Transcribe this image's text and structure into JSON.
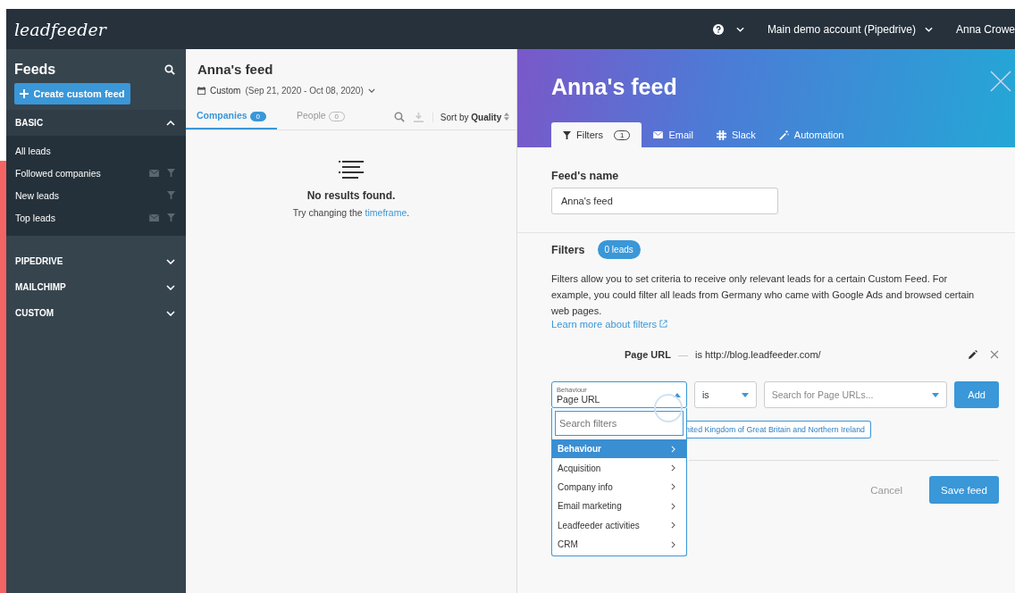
{
  "topbar": {
    "logo": "leadfeeder",
    "account": "Main demo account (Pipedrive)",
    "user": "Anna Crowe"
  },
  "sidebar": {
    "title": "Feeds",
    "create_button": "Create custom feed",
    "sections": [
      {
        "label": "BASIC",
        "expanded": true,
        "items": [
          {
            "label": "All leads",
            "email_alert": false,
            "filtered": false
          },
          {
            "label": "Followed companies",
            "email_alert": true,
            "filtered": true
          },
          {
            "label": "New leads",
            "email_alert": false,
            "filtered": true
          },
          {
            "label": "Top leads",
            "email_alert": true,
            "filtered": true
          }
        ]
      },
      {
        "label": "PIPEDRIVE",
        "expanded": false
      },
      {
        "label": "MAILCHIMP",
        "expanded": false
      },
      {
        "label": "CUSTOM",
        "expanded": false
      }
    ]
  },
  "feed": {
    "title": "Anna's feed",
    "range_label": "Custom",
    "range": "(Sep 21, 2020 - Oct 08, 2020)",
    "tabs": [
      {
        "label": "Companies",
        "count": "0",
        "selected": true
      },
      {
        "label": "People",
        "count": "0",
        "selected": false
      }
    ],
    "sort_label": "Sort by",
    "sort_value": "Quality",
    "empty_title": "No results found.",
    "empty_text": "Try changing the",
    "empty_link": "timeframe",
    "empty_end": "."
  },
  "editor": {
    "title": "Anna's feed",
    "tabs": [
      {
        "kind": "filter",
        "label": "Filters",
        "count": "1",
        "selected": true
      },
      {
        "kind": "email",
        "label": "Email",
        "selected": false
      },
      {
        "kind": "slack",
        "label": "Slack",
        "selected": false
      },
      {
        "kind": "automation",
        "label": "Automation",
        "selected": false
      }
    ],
    "name_label": "Feed's name",
    "name_value": "Anna's feed",
    "filters_heading": "Filters",
    "leads_badge": "0 leads",
    "description": "Filters allow you to set criteria to receive only relevant leads for a certain Custom Feed. For example, you could filter all leads from Germany who came with Google Ads and browsed certain web pages.",
    "learn_more": "Learn more about filters",
    "existing_filter": {
      "field": "Page URL",
      "dash": "—",
      "operator": "is",
      "value": "http://blog.leadfeeder.com/"
    },
    "new_filter": {
      "category": "Behaviour",
      "field": "Page URL",
      "operator": "is",
      "value_placeholder": "Search for Page URLs...",
      "add_button": "Add"
    },
    "chip": "nited Kingdom of Great Britain and Northern Ireland",
    "dropdown": {
      "search_placeholder": "Search filters",
      "items": [
        {
          "label": "Behaviour",
          "selected": true
        },
        {
          "label": "Acquisition",
          "selected": false
        },
        {
          "label": "Company info",
          "selected": false
        },
        {
          "label": "Email marketing",
          "selected": false
        },
        {
          "label": "Leadfeeder activities",
          "selected": false
        },
        {
          "label": "CRM",
          "selected": false
        }
      ]
    },
    "cancel": "Cancel",
    "save": "Save feed"
  }
}
